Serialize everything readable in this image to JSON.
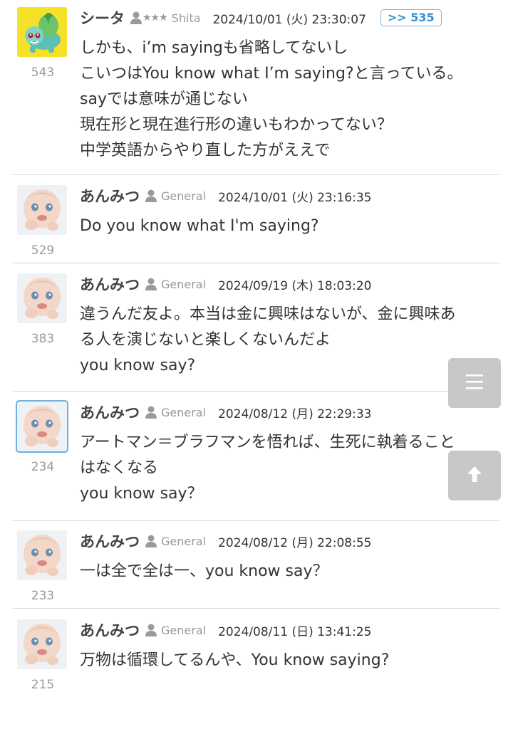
{
  "posts": [
    {
      "name": "シータ",
      "rank_icon": "person-icon",
      "stars": "★★★",
      "rank": "Shita",
      "date": "2024/10/01 (火) 23:30:07",
      "reply": ">> 535",
      "number": "543",
      "avatar": "bulbasaur-avatar",
      "lines": [
        "しかも、i’m sayingも省略してないし",
        "こいつはYou know what I’m saying?と言っている。",
        "sayでは意味が通じない",
        "現在形と現在進行形の違いもわかってない？",
        "中学英語からやり直した方がええで"
      ]
    },
    {
      "name": "あんみつ",
      "rank_icon": "person-icon",
      "rank": "General",
      "date": "2024/10/01 (火) 23:16:35",
      "number": "529",
      "avatar": "baby-avatar",
      "lines": [
        "Do you know what I'm saying?"
      ]
    },
    {
      "name": "あんみつ",
      "rank_icon": "person-icon",
      "rank": "General",
      "date": "2024/09/19 (木) 18:03:20",
      "number": "383",
      "avatar": "baby-avatar",
      "lines": [
        "違うんだ友よ。本当は金に興味はないが、金に興味あ",
        "る人を演じないと楽しくないんだよ",
        "you know say?"
      ]
    },
    {
      "name": "あんみつ",
      "rank_icon": "person-icon",
      "rank": "General",
      "date": "2024/08/12 (月) 22:29:33",
      "number": "234",
      "avatar": "baby-avatar",
      "lines": [
        "アートマン＝ブラフマンを悟れば、生死に執着ること",
        "はなくなる",
        "you know say？"
      ]
    },
    {
      "name": "あんみつ",
      "rank_icon": "person-icon",
      "rank": "General",
      "date": "2024/08/12 (月) 22:08:55",
      "number": "233",
      "avatar": "baby-avatar",
      "lines": [
        "一は全で全は一、you know say？"
      ]
    },
    {
      "name": "あんみつ",
      "rank_icon": "person-icon",
      "rank": "General",
      "date": "2024/08/11 (日) 13:41:25",
      "number": "215",
      "avatar": "baby-avatar",
      "lines": [
        "万物は循環してるんや、You know saying?"
      ]
    }
  ],
  "buttons": {
    "menu_icon": "menu-icon",
    "top_icon": "arrow-up-icon"
  },
  "colors": {
    "reply_badge": "#3a8fd0",
    "floating_button": "#c8c8c8",
    "selection_outline": "#6fb0e0",
    "muted_text": "#9a9a9a"
  }
}
